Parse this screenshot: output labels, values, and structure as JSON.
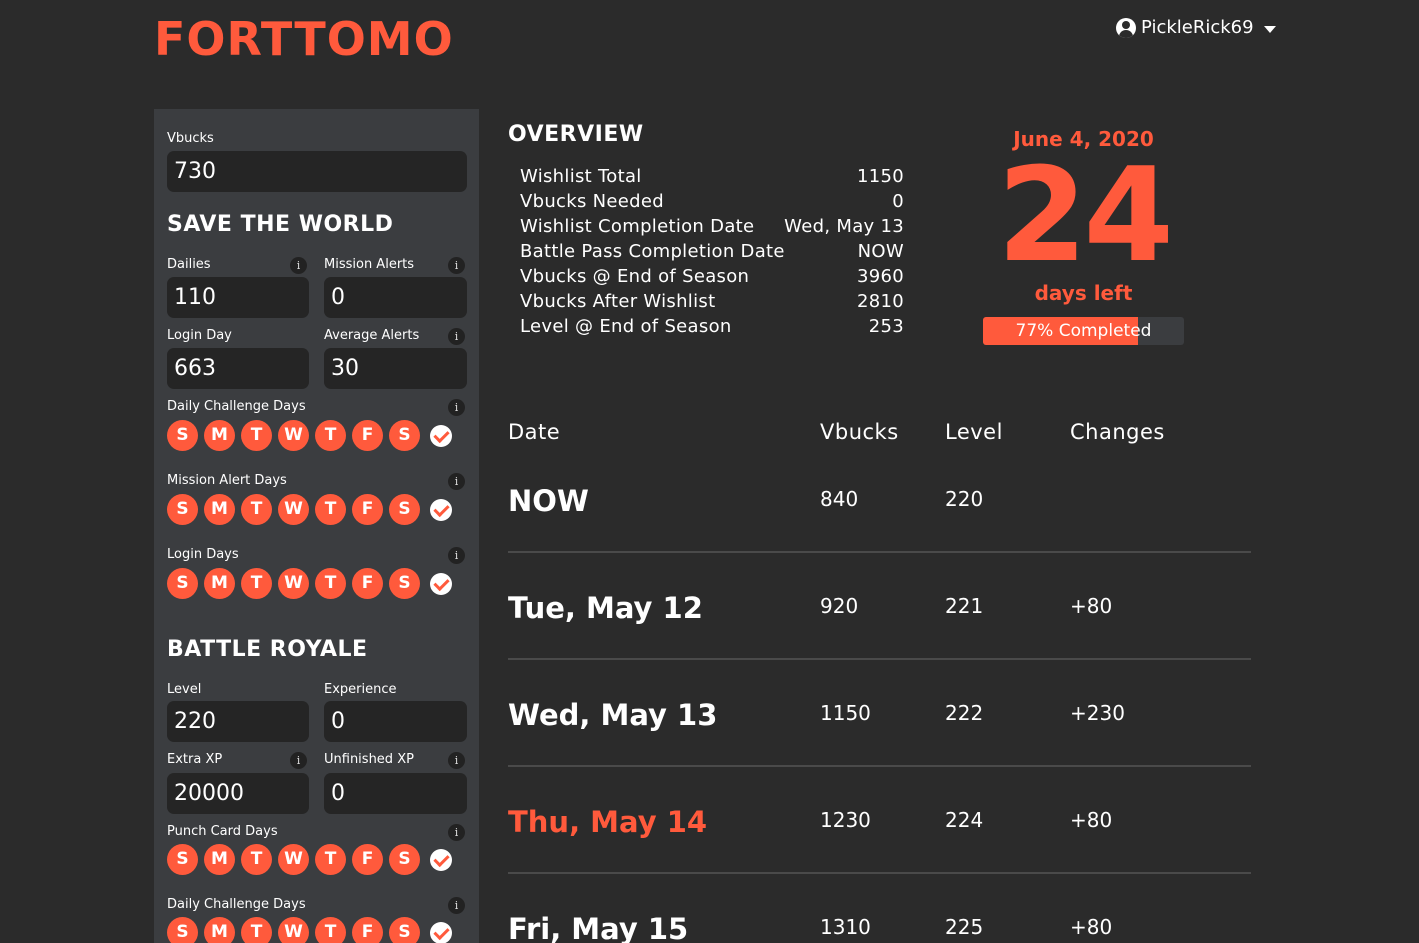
{
  "app": {
    "logo": "FORTTOMO"
  },
  "user": {
    "name": "PickleRick69"
  },
  "sidebar": {
    "vbucks": {
      "label": "Vbucks",
      "value": "730"
    },
    "stw": {
      "title": "SAVE THE WORLD",
      "dailies": {
        "label": "Dailies",
        "value": "110"
      },
      "mission_alerts": {
        "label": "Mission Alerts",
        "value": "0"
      },
      "login_day": {
        "label": "Login Day",
        "value": "663"
      },
      "average_alerts": {
        "label": "Average Alerts",
        "value": "30"
      },
      "daily_challenge_days": {
        "label": "Daily Challenge Days"
      },
      "mission_alert_days": {
        "label": "Mission Alert Days"
      },
      "login_days": {
        "label": "Login Days"
      }
    },
    "br": {
      "title": "BATTLE ROYALE",
      "level": {
        "label": "Level",
        "value": "220"
      },
      "experience": {
        "label": "Experience",
        "value": "0"
      },
      "extra_xp": {
        "label": "Extra XP",
        "value": "20000"
      },
      "unfinished_xp": {
        "label": "Unfinished XP",
        "value": "0"
      },
      "punch_card_days": {
        "label": "Punch Card Days"
      },
      "daily_challenge_days": {
        "label": "Daily Challenge Days"
      }
    },
    "weekdays": [
      "S",
      "M",
      "T",
      "W",
      "T",
      "F",
      "S"
    ],
    "info_glyph": "i"
  },
  "overview": {
    "title": "OVERVIEW",
    "rows": [
      {
        "label": "Wishlist Total",
        "value": "1150"
      },
      {
        "label": "Vbucks Needed",
        "value": "0"
      },
      {
        "label": "Wishlist Completion Date",
        "value": "Wed, May 13"
      },
      {
        "label": "Battle Pass Completion Date",
        "value": "NOW"
      },
      {
        "label": "Vbucks @ End of Season",
        "value": "3960"
      },
      {
        "label": "Vbucks After Wishlist",
        "value": "2810"
      },
      {
        "label": "Level @ End of Season",
        "value": "253"
      }
    ]
  },
  "countdown": {
    "date": "June 4, 2020",
    "days": "24",
    "days_label": "days left",
    "progress_text": "77% Completed",
    "progress_fraction": 0.77
  },
  "table": {
    "headers": {
      "date": "Date",
      "vbucks": "Vbucks",
      "level": "Level",
      "changes": "Changes"
    },
    "rows": [
      {
        "date": "NOW",
        "vbucks": "840",
        "level": "220",
        "changes": ""
      },
      {
        "date": "Tue, May 12",
        "vbucks": "920",
        "level": "221",
        "changes": "+80"
      },
      {
        "date": "Wed, May 13",
        "vbucks": "1150",
        "level": "222",
        "changes": "+230"
      },
      {
        "date": "Thu, May 14",
        "vbucks": "1230",
        "level": "224",
        "changes": "+80"
      },
      {
        "date": "Fri, May 15",
        "vbucks": "1310",
        "level": "225",
        "changes": "+80"
      }
    ]
  },
  "colors": {
    "accent": "#ff5a3c",
    "background": "#2b2b2b",
    "panel": "#3b3d40",
    "input": "#252525"
  }
}
